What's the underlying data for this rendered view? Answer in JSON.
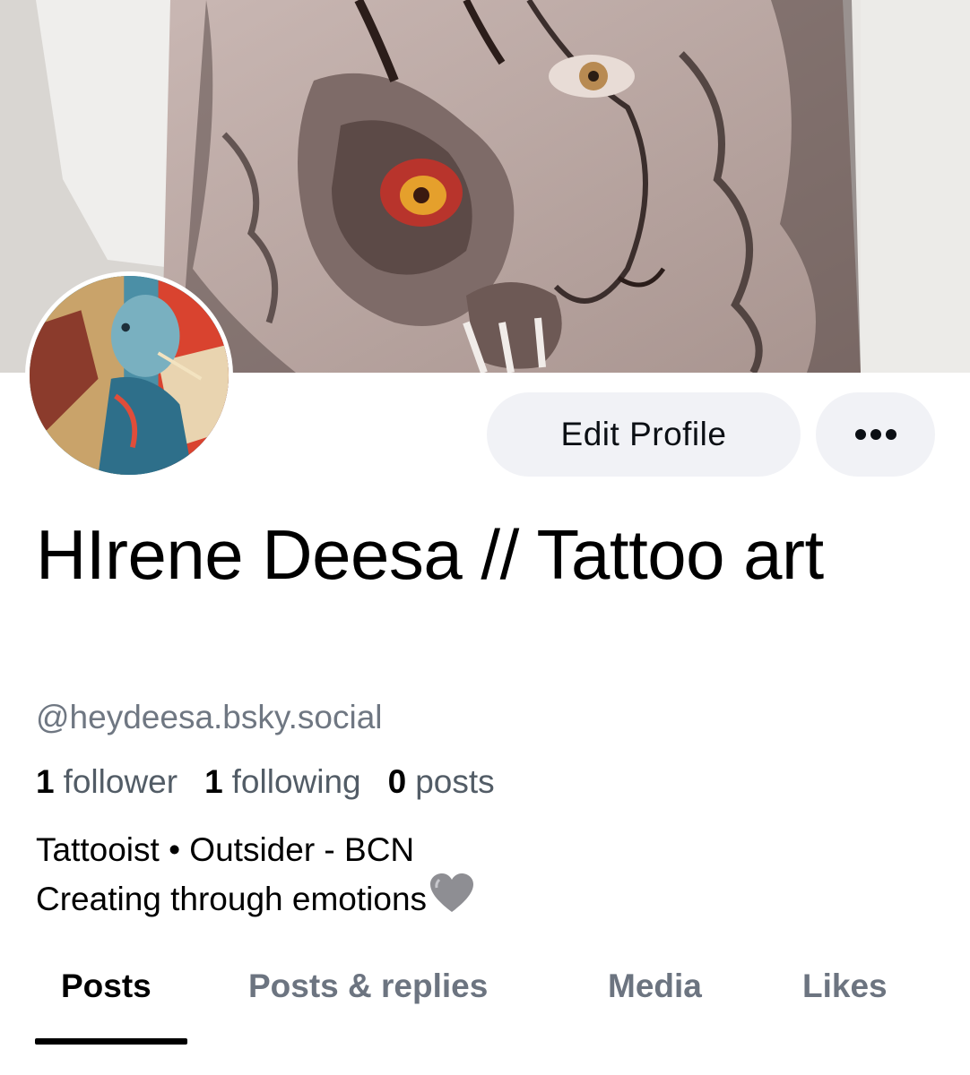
{
  "profile": {
    "display_name": "HIrene Deesa // Tattoo art",
    "handle": "@heydeesa.bsky.social",
    "avatar_icon": "avatar-photo",
    "banner_icon": "banner-photo"
  },
  "actions": {
    "edit_profile_label": "Edit Profile",
    "more_icon": "ellipsis-icon"
  },
  "stats": {
    "followers_count": "1",
    "followers_label": "follower",
    "following_count": "1",
    "following_label": "following",
    "posts_count": "0",
    "posts_label": "posts"
  },
  "bio": {
    "line1": "Tattooist • Outsider - BCN",
    "line2": "Creating through emotions"
  },
  "tabs": [
    {
      "label": "Posts",
      "active": true
    },
    {
      "label": "Posts & replies",
      "active": false
    },
    {
      "label": "Media",
      "active": false
    },
    {
      "label": "Likes",
      "active": false
    }
  ],
  "colors": {
    "button_bg": "#f1f2f6",
    "muted_text": "#6f7782",
    "tab_inactive": "#6c7480"
  }
}
